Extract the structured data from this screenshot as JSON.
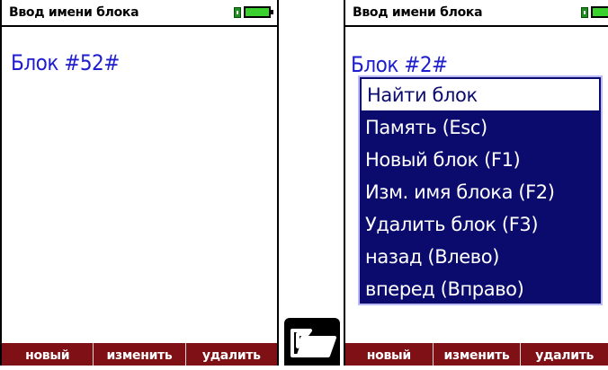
{
  "left_screen": {
    "title": "Ввод имени блока",
    "block_name": "Блок #52#",
    "softkeys": [
      "новый",
      "изменить",
      "удалить"
    ]
  },
  "right_screen": {
    "title": "Ввод имени блока",
    "block_name": "Блок #2#",
    "menu": {
      "selected_index": 0,
      "items": [
        "Найти блок",
        "Память (Esc)",
        "Новый блок (F1)",
        "Изм. имя блока (F2)",
        "Удалить блок (F3)",
        "назад (Влево)",
        "вперед (Вправо)"
      ]
    },
    "softkeys": [
      "новый",
      "изменить",
      "удалить"
    ]
  },
  "center": {
    "icon": "folder-open-icon"
  },
  "colors": {
    "softkey_bar": "#7f1116",
    "menu_bg": "#0b0b6e",
    "block_name_text": "#1e1ecf",
    "battery_fill": "#3ad12f"
  }
}
